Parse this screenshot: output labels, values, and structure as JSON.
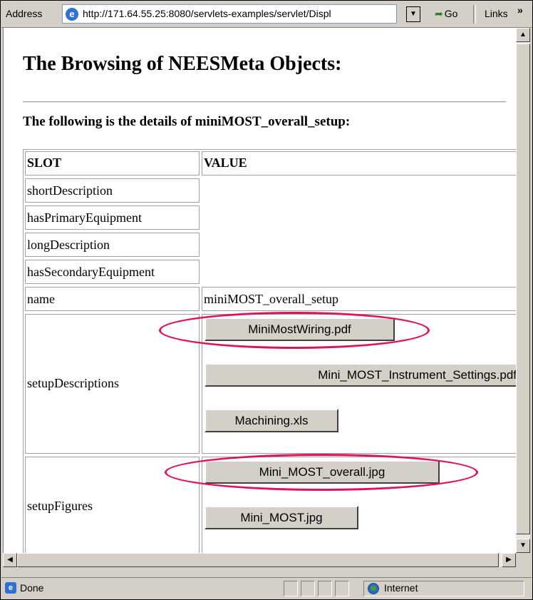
{
  "toolbar": {
    "address_label": "Address",
    "url": "http://171.64.55.25:8080/servlets-examples/servlet/Displ",
    "go_label": "Go",
    "links_label": "Links"
  },
  "page": {
    "title": "The Browsing of NEESMeta Objects:",
    "subtitle": "The following is the details of miniMOST_overall_setup:"
  },
  "table": {
    "headers": [
      "SLOT",
      "VALUE"
    ],
    "rows": [
      {
        "slot": "shortDescription",
        "value": ""
      },
      {
        "slot": "hasPrimaryEquipment",
        "value": ""
      },
      {
        "slot": "longDescription",
        "value": ""
      },
      {
        "slot": "hasSecondaryEquipment",
        "value": ""
      },
      {
        "slot": "name",
        "value": "miniMOST_overall_setup"
      },
      {
        "slot": "setupDescriptions",
        "files": [
          "MiniMostWiring.pdf",
          "Mini_MOST_Instrument_Settings.pdf",
          "Machining.xls"
        ]
      },
      {
        "slot": "setupFigures",
        "files": [
          "Mini_MOST_overall.jpg",
          "Mini_MOST.jpg"
        ]
      }
    ]
  },
  "highlight_color": "#e0115f",
  "status": {
    "text": "Done",
    "zone": "Internet"
  }
}
